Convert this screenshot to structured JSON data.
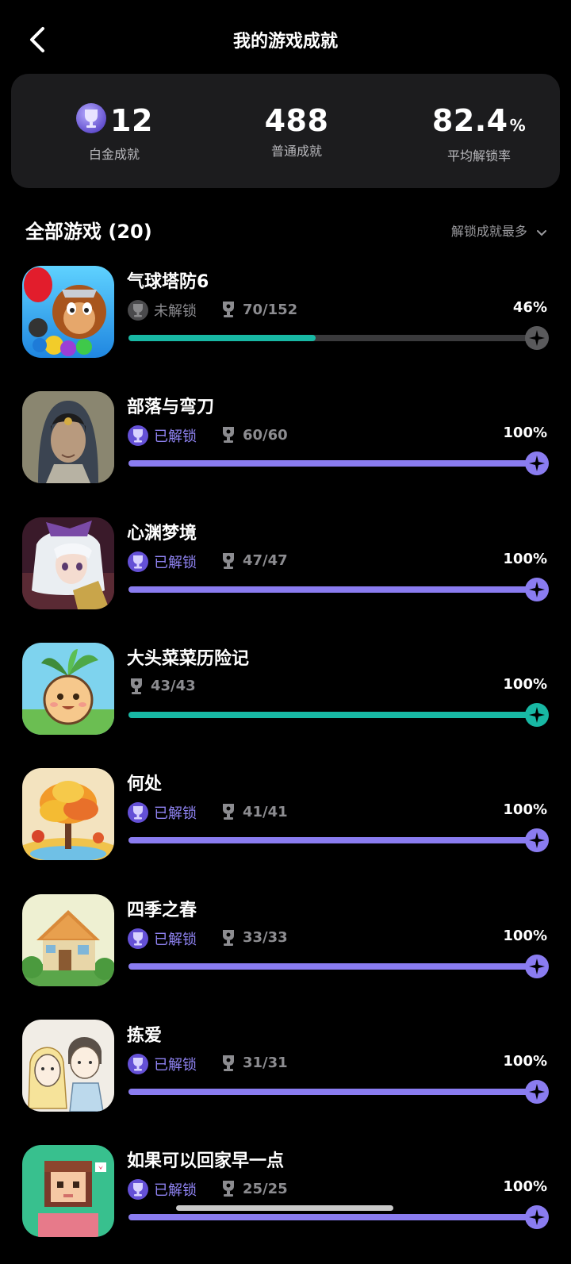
{
  "header": {
    "title": "我的游戏成就"
  },
  "stats": {
    "platinum": {
      "value": "12",
      "label": "白金成就"
    },
    "normal": {
      "value": "488",
      "label": "普通成就"
    },
    "rate": {
      "value": "82.4",
      "unit": "%",
      "label": "平均解锁率"
    }
  },
  "section": {
    "title": "全部游戏 (20)",
    "sort_label": "解锁成就最多"
  },
  "colors": {
    "accent": "#8a7cf0",
    "teal": "#18b8a4",
    "track": "#3a3a3c",
    "card": "#1c1c1e"
  },
  "games": [
    {
      "name": "气球塔防6",
      "status": "未解锁",
      "has_status": true,
      "unlocked": false,
      "count": "70/152",
      "percent_label": "46%",
      "progress": 0.46,
      "bar_color": "teal"
    },
    {
      "name": "部落与弯刀",
      "status": "已解锁",
      "has_status": true,
      "unlocked": true,
      "count": "60/60",
      "percent_label": "100%",
      "progress": 1.0,
      "bar_color": "accent"
    },
    {
      "name": "心渊梦境",
      "status": "已解锁",
      "has_status": true,
      "unlocked": true,
      "count": "47/47",
      "percent_label": "100%",
      "progress": 1.0,
      "bar_color": "accent"
    },
    {
      "name": "大头菜菜历险记",
      "status": "",
      "has_status": false,
      "unlocked": false,
      "count": "43/43",
      "percent_label": "100%",
      "progress": 1.0,
      "bar_color": "teal"
    },
    {
      "name": "何处",
      "status": "已解锁",
      "has_status": true,
      "unlocked": true,
      "count": "41/41",
      "percent_label": "100%",
      "progress": 1.0,
      "bar_color": "accent"
    },
    {
      "name": "四季之春",
      "status": "已解锁",
      "has_status": true,
      "unlocked": true,
      "count": "33/33",
      "percent_label": "100%",
      "progress": 1.0,
      "bar_color": "accent"
    },
    {
      "name": "拣爱",
      "status": "已解锁",
      "has_status": true,
      "unlocked": true,
      "count": "31/31",
      "percent_label": "100%",
      "progress": 1.0,
      "bar_color": "accent"
    },
    {
      "name": "如果可以回家早一点",
      "status": "已解锁",
      "has_status": true,
      "unlocked": true,
      "count": "25/25",
      "percent_label": "100%",
      "progress": 1.0,
      "bar_color": "accent"
    }
  ]
}
